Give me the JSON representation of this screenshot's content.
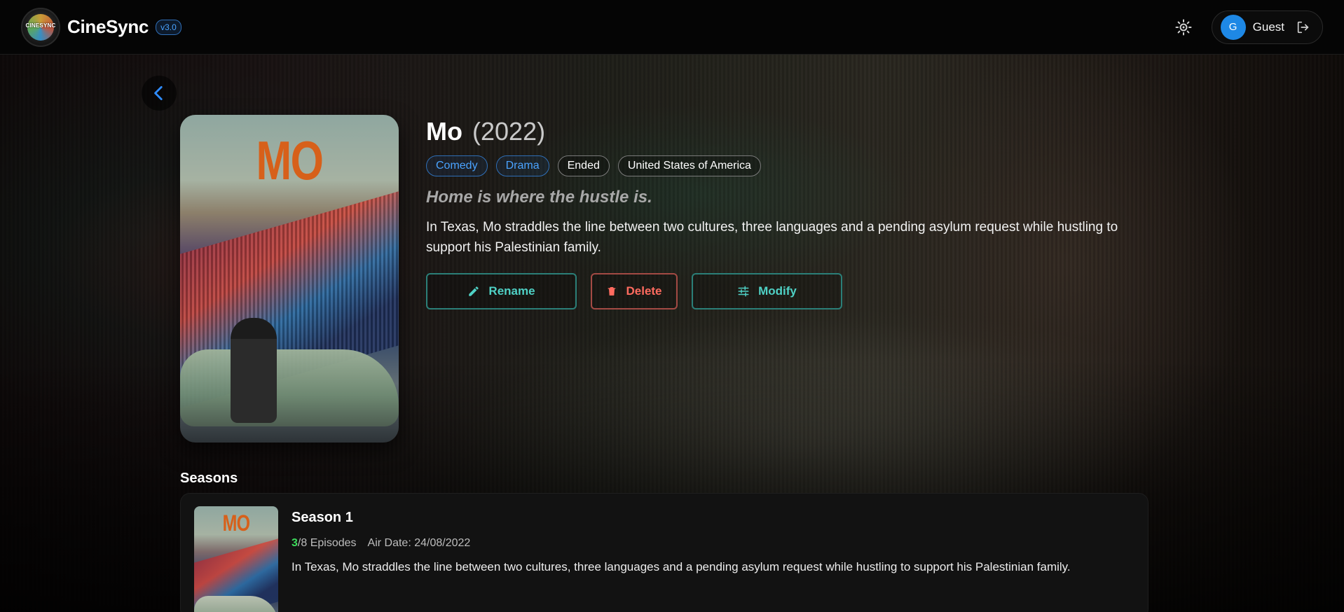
{
  "header": {
    "logo_text": "CINESYNC",
    "brand": "CineSync",
    "version": "v3.0",
    "user": {
      "initial": "G",
      "name": "Guest"
    }
  },
  "show": {
    "title": "Mo",
    "year": "(2022)",
    "poster_text": "MO",
    "tags": [
      {
        "label": "Comedy",
        "kind": "genre"
      },
      {
        "label": "Drama",
        "kind": "genre"
      },
      {
        "label": "Ended",
        "kind": "status"
      },
      {
        "label": "United States of America",
        "kind": "country"
      }
    ],
    "tagline": "Home is where the hustle is.",
    "overview": "In Texas, Mo straddles the line between two cultures, three languages and a pending asylum request while hustling to support his Palestinian family."
  },
  "actions": {
    "rename": "Rename",
    "delete": "Delete",
    "modify": "Modify"
  },
  "seasons": {
    "heading": "Seasons",
    "items": [
      {
        "title": "Season 1",
        "thumb_text": "MO",
        "watched": "3",
        "total": "/8 Episodes",
        "air_date": "Air Date: 24/08/2022",
        "overview": "In Texas, Mo straddles the line between two cultures, three languages and a pending asylum request while hustling to support his Palestinian family."
      }
    ]
  },
  "colors": {
    "accent_teal": "#4fd1c5",
    "danger": "#ff6b5f",
    "genre_blue": "#4aa3ff",
    "avatar_blue": "#1e88e5",
    "watched_green": "#3ddc5c"
  },
  "icons": {
    "theme": "sun-icon",
    "logout": "logout-icon",
    "back": "chevron-left-icon",
    "rename": "pencil-icon",
    "delete": "trash-icon",
    "modify": "sliders-icon"
  }
}
